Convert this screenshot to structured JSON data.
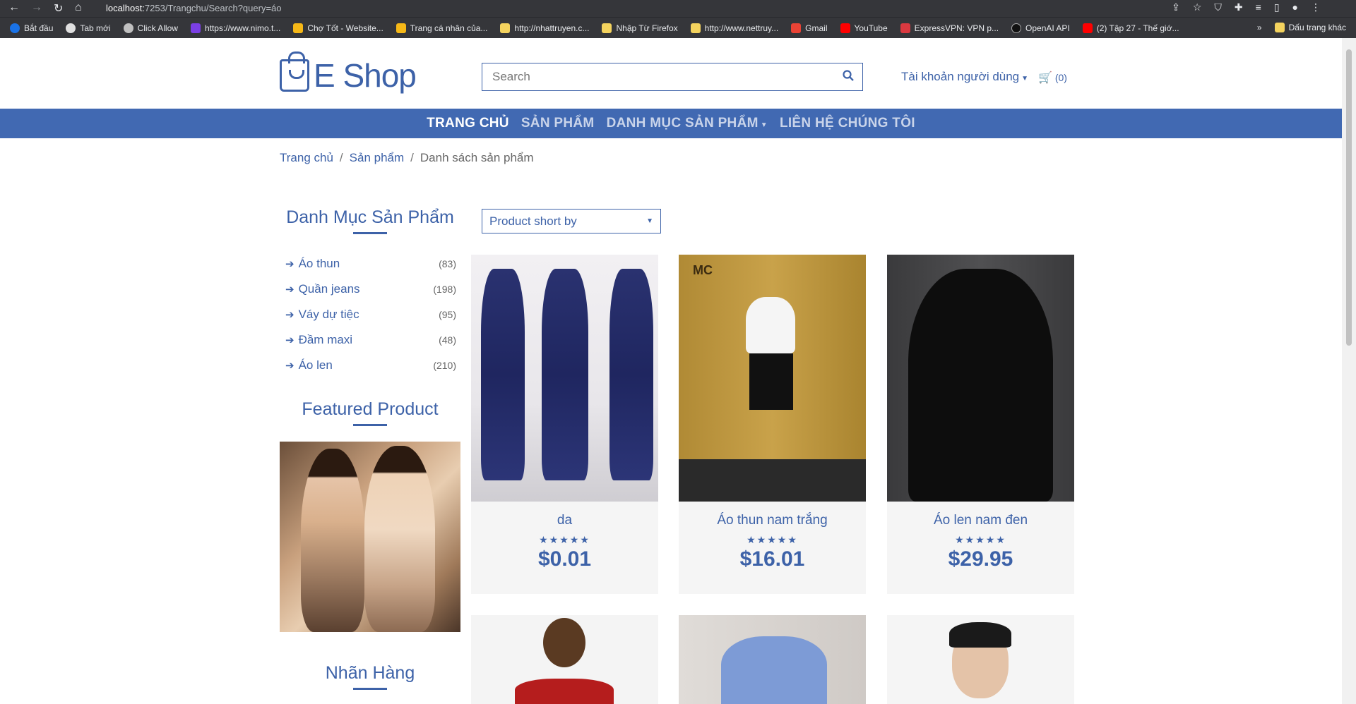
{
  "browser": {
    "url_host": "localhost:",
    "url_rest": "7253/Trangchu/Search?query=áo",
    "bookmarks": [
      "Bắt đầu",
      "Tab mới",
      "Click Allow",
      "https://www.nimo.t...",
      "Chợ Tốt - Website...",
      "Trang cá nhân của...",
      "http://nhattruyen.c...",
      "Nhập Từ Firefox",
      "http://www.nettruy...",
      "Gmail",
      "YouTube",
      "ExpressVPN: VPN p...",
      "OpenAI API",
      "(2) Tập 27 - Thế giớ..."
    ],
    "more_bookmarks": "»",
    "other_bookmarks": "Dấu trang khác"
  },
  "header": {
    "logo_text": "E Shop",
    "search_placeholder": "Search",
    "account_label": "Tài khoản người dùng",
    "cart_count": "(0)"
  },
  "nav": {
    "items": [
      "TRANG CHỦ",
      "SẢN PHẨM",
      "DANH MỤC SẢN PHẨM",
      "LIÊN HỆ CHÚNG TÔI"
    ]
  },
  "breadcrumb": {
    "home": "Trang chủ",
    "products": "Sản phẩm",
    "current": "Danh sách sản phẩm"
  },
  "sidebar": {
    "categories_title": "Danh Mục Sản Phẩm",
    "categories": [
      {
        "name": "Áo thun",
        "count": "(83)"
      },
      {
        "name": "Quần jeans",
        "count": "(198)"
      },
      {
        "name": "Váy dự tiệc",
        "count": "(95)"
      },
      {
        "name": "Đầm maxi",
        "count": "(48)"
      },
      {
        "name": "Áo len",
        "count": "(210)"
      }
    ],
    "featured_title": "Featured Product",
    "brands_title": "Nhãn Hàng"
  },
  "sort": {
    "label": "Product short by"
  },
  "products": [
    {
      "name": "da",
      "stars": "★★★★★",
      "price": "$0.01"
    },
    {
      "name": "Áo thun nam trắng",
      "stars": "★★★★★",
      "price": "$16.01"
    },
    {
      "name": "Áo len nam đen",
      "stars": "★★★★★",
      "price": "$29.95"
    }
  ],
  "product_image_brand": "MC"
}
